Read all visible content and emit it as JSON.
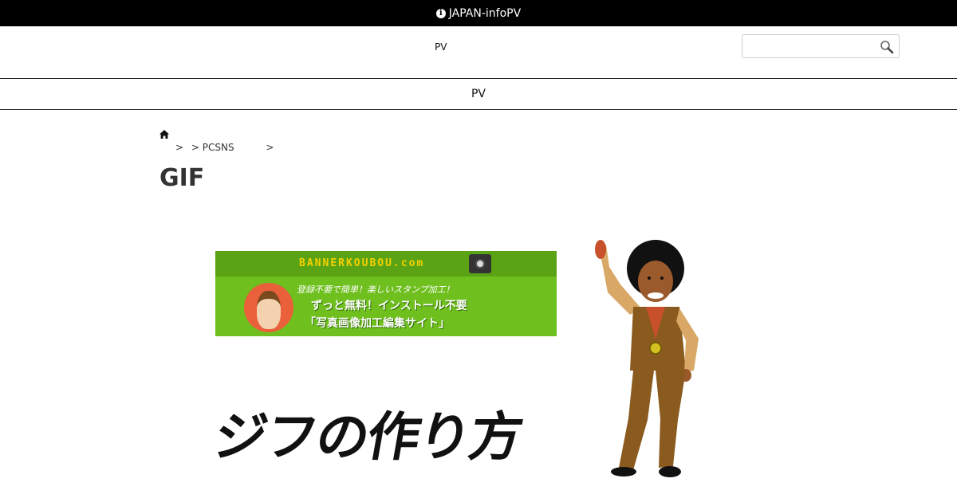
{
  "topbar": {
    "icon": "info-circle-icon",
    "text": "JAPAN-infoPV"
  },
  "header": {
    "site_title": "PV",
    "search": {
      "placeholder": "",
      "icon": "search-icon"
    }
  },
  "nav": {
    "label": "PV"
  },
  "breadcrumb": {
    "icon": "home-icon",
    "items": [
      ">",
      "> PCSNS",
      ">"
    ]
  },
  "article": {
    "title": "GIF",
    "hero": {
      "banner": {
        "brand": "BANNERKOUBOU.com",
        "tagline": "登録不要で簡単！楽しいスタンプ加工！",
        "line1": "ずっと無料！インストール不要",
        "line2": "「写真画像加工編集サイト」"
      },
      "heading": "ジフの作り方"
    }
  }
}
